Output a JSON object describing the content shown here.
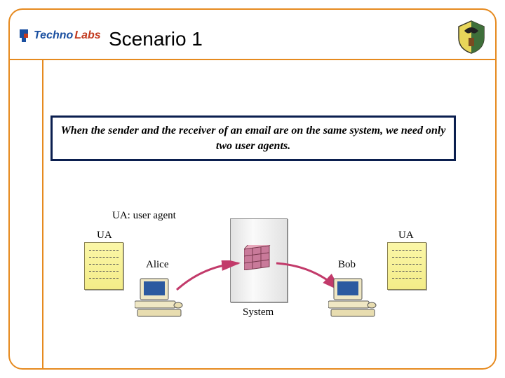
{
  "logo": {
    "part1": "Techno",
    "part2": "Labs"
  },
  "title": "Scenario 1",
  "callout": "When the sender and the receiver of an email are on the same system, we need only two user agents.",
  "diagram": {
    "legend": "UA: user agent",
    "leftUA": "UA",
    "rightUA": "UA",
    "leftUser": "Alice",
    "rightUser": "Bob",
    "systemLabel": "System"
  }
}
